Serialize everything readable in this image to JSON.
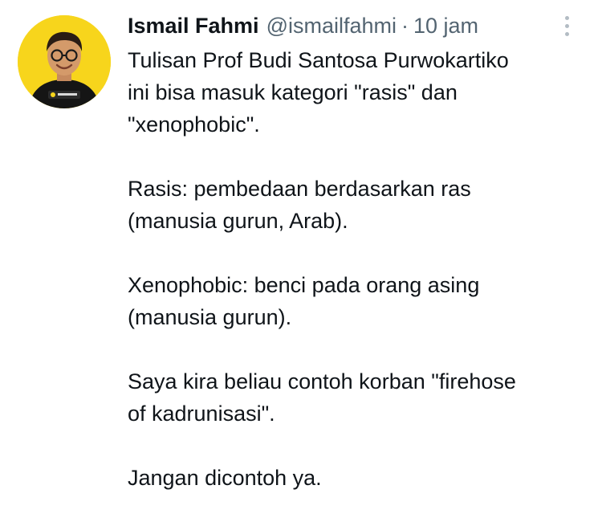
{
  "author": {
    "display_name": "Ismail Fahmi",
    "handle": "@ismailfahmi",
    "separator": "·",
    "time": "10 jam",
    "avatar_background": "#f7d51c",
    "avatar_shirt_text": "Drone Emprit"
  },
  "menu": {
    "icon": "more-vertical-icon"
  },
  "tweet": {
    "lines": [
      "Tulisan Prof Budi Santosa Purwokartiko",
      "ini bisa masuk kategori \"rasis\" dan",
      "\"xenophobic\".",
      "Rasis: pembedaan berdasarkan ras",
      "(manusia gurun, Arab).",
      "Xenophobic: benci pada orang asing",
      "(manusia gurun).",
      "Saya kira beliau contoh korban \"firehose",
      "of kadrunisasi\".",
      "Jangan dicontoh ya."
    ]
  },
  "colors": {
    "text_primary": "#0f1419",
    "text_secondary": "#536471"
  }
}
